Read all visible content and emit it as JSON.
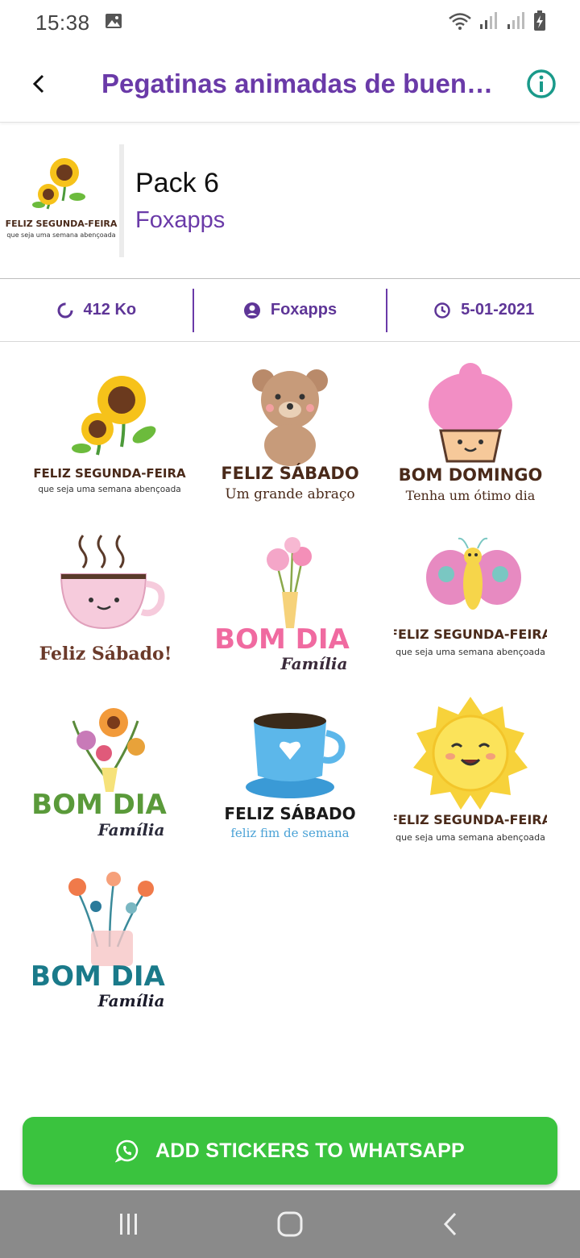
{
  "status_bar": {
    "time": "15:38"
  },
  "app_bar": {
    "title": "Pegatinas animadas de buen…"
  },
  "pack": {
    "name": "Pack 6",
    "publisher": "Foxapps"
  },
  "info_row": {
    "size": "412 Ko",
    "author": "Foxapps",
    "date": "5-01-2021"
  },
  "stickers": [
    {
      "line1": "FELIZ SEGUNDA-FEIRA",
      "line2": "que seja uma semana abençoada"
    },
    {
      "line1": "FELIZ SÁBADO",
      "line2": "Um grande abraço"
    },
    {
      "line1": "BOM DOMINGO",
      "line2": "Tenha um ótimo dia"
    },
    {
      "line1": "Feliz Sábado!"
    },
    {
      "line1": "BOM DIA",
      "line2": "Família"
    },
    {
      "line1": "FELIZ SEGUNDA-FEIRA",
      "line2": "que seja uma semana abençoada"
    },
    {
      "line1": "BOM DIA",
      "line2": "Família"
    },
    {
      "line1": "FELIZ SÁBADO",
      "line2": "feliz fim de semana"
    },
    {
      "line1": "FELIZ SEGUNDA-FEIRA",
      "line2": "que seja uma semana abençoada"
    },
    {
      "line1": "BOM DIA",
      "line2": "Família"
    }
  ],
  "tray": {
    "line1": "FELIZ SEGUNDA-FEIRA",
    "line2": "que seja uma semana abençoada"
  },
  "add_button": {
    "label": "ADD STICKERS TO WHATSAPP"
  },
  "colors": {
    "accent": "#6a3aa8",
    "button": "#3ac33e",
    "info_icon": "#1a9a8a",
    "nav_bar": "#8a8a8a"
  }
}
